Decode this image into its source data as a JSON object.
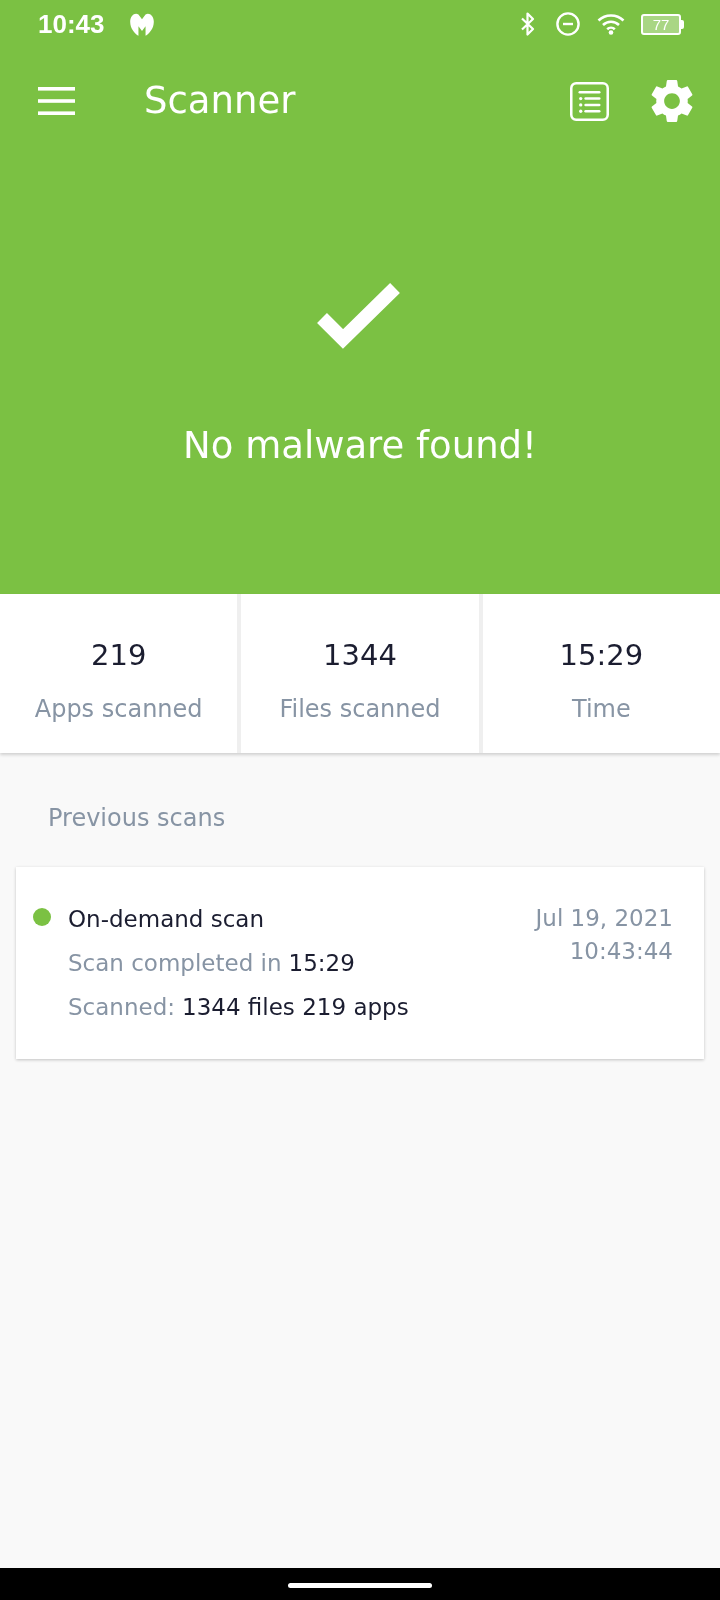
{
  "status_bar": {
    "time": "10:43",
    "battery": "77"
  },
  "toolbar": {
    "title": "Scanner"
  },
  "result": {
    "message": "No malware found!"
  },
  "stats": [
    {
      "value": "219",
      "label": "Apps scanned"
    },
    {
      "value": "1344",
      "label": "Files scanned"
    },
    {
      "value": "15:29",
      "label": "Time"
    }
  ],
  "previous_scans": {
    "heading": "Previous scans",
    "items": [
      {
        "title": "On-demand scan",
        "color": "#7bc143",
        "details": [
          {
            "label": "Scan completed in",
            "value": "15:29"
          },
          {
            "label": "Scanned:",
            "value": "1344 files 219 apps"
          }
        ],
        "date": "Jul 19, 2021",
        "time": "10:43:44"
      }
    ]
  }
}
